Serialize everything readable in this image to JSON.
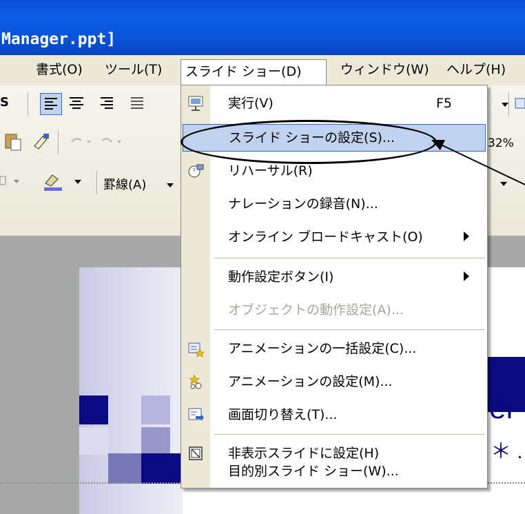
{
  "window": {
    "title": "Manager.ppt]",
    "title_visible": "Manager.ppt]"
  },
  "menubar": {
    "items": [
      {
        "label": "書式(O)"
      },
      {
        "label": "ツール(T)"
      },
      {
        "label": "スライド ショー(D)",
        "open": true
      },
      {
        "label": "ウィンドウ(W)"
      },
      {
        "label": "ヘルプ(H)"
      }
    ]
  },
  "toolbar": {
    "borders_label": "罫線(A)",
    "zoom_value": "32%",
    "fragment_s": "S"
  },
  "slide": {
    "text_er": "er",
    "text_star": "＊ ."
  },
  "dropdown": {
    "items": [
      {
        "label": "実行(V)",
        "shortcut": "F5",
        "icon": "slideshow-run-icon"
      },
      {
        "label": "スライド ショーの設定(S)...",
        "highlighted": true
      },
      {
        "label": "リハーサル(R)",
        "icon": "rehearse-timings-icon"
      },
      {
        "label": "ナレーションの録音(N)..."
      },
      {
        "label": "オンライン ブロードキャスト(O)",
        "submenu": true
      },
      {
        "label": "動作設定ボタン(I)",
        "submenu": true
      },
      {
        "label": "オブジェクトの動作設定(A)...",
        "disabled": true
      },
      {
        "label": "アニメーションの一括設定(C)...",
        "icon": "animation-schemes-icon"
      },
      {
        "label": "アニメーションの設定(M)...",
        "icon": "custom-animation-icon"
      },
      {
        "label": "画面切り替え(T)...",
        "icon": "slide-transition-icon"
      },
      {
        "label": "非表示スライドに設定(H)",
        "icon": "hide-slide-icon"
      },
      {
        "label": "目的別スライド ショー(W)..."
      }
    ]
  },
  "colors": {
    "titlebar": "#0a52d8",
    "menu_highlight": "#c1d2ee",
    "menu_highlight_border": "#316ac5",
    "slide_dark_blue": "#0a0a82"
  }
}
